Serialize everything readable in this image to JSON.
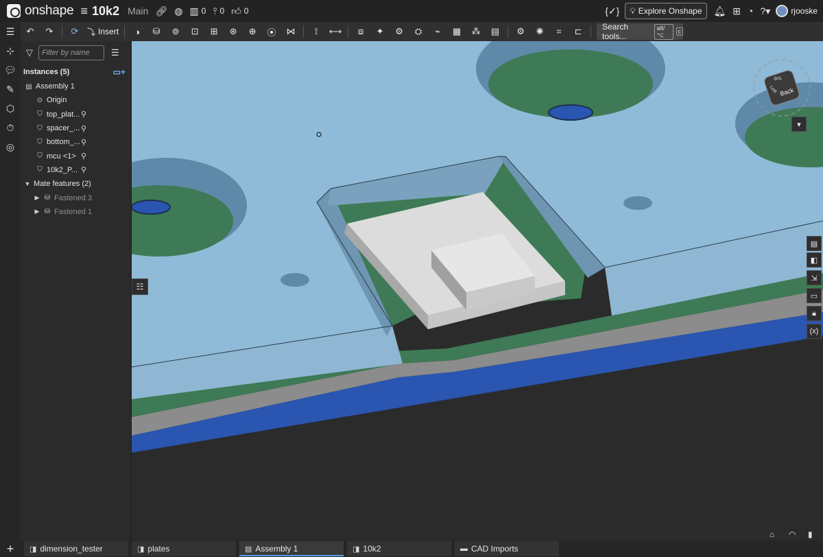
{
  "topbar": {
    "brand": "onshape",
    "doc_name": "10k2",
    "branch": "Main",
    "versions_count": "0",
    "branches_count": "0",
    "likes_count": "0",
    "explore_label": "Explore Onshape",
    "username": "rjooske"
  },
  "toolbar": {
    "insert_label": "Insert",
    "search_label": "Search tools...",
    "search_shortcut_1": "alt/⌥",
    "search_shortcut_2": "c"
  },
  "panel": {
    "filter_placeholder": "Filter by name",
    "instances_header": "Instances (5)",
    "assembly": "Assembly 1",
    "origin": "Origin",
    "instances": [
      "top_plat...",
      "spacer_...",
      "bottom_...",
      "mcu <1>",
      "10k2_P..."
    ],
    "mates_header": "Mate features (2)",
    "mates": [
      "Fastened 3",
      "Fastened 1"
    ]
  },
  "viewcube": {
    "face_back": "Back",
    "face_top": "Top",
    "face_left": "Left"
  },
  "tabs": [
    "dimension_tester",
    "plates",
    "Assembly 1",
    "10k2",
    "CAD Imports"
  ],
  "active_tab": "Assembly 1",
  "colors": {
    "plate_blue": "#8fbbd8",
    "spacer_green": "#3e7a55",
    "gray_layer": "#8a8a8a",
    "bottom_blue": "#2a55b0",
    "mcu_white": "#dcdcdc"
  }
}
